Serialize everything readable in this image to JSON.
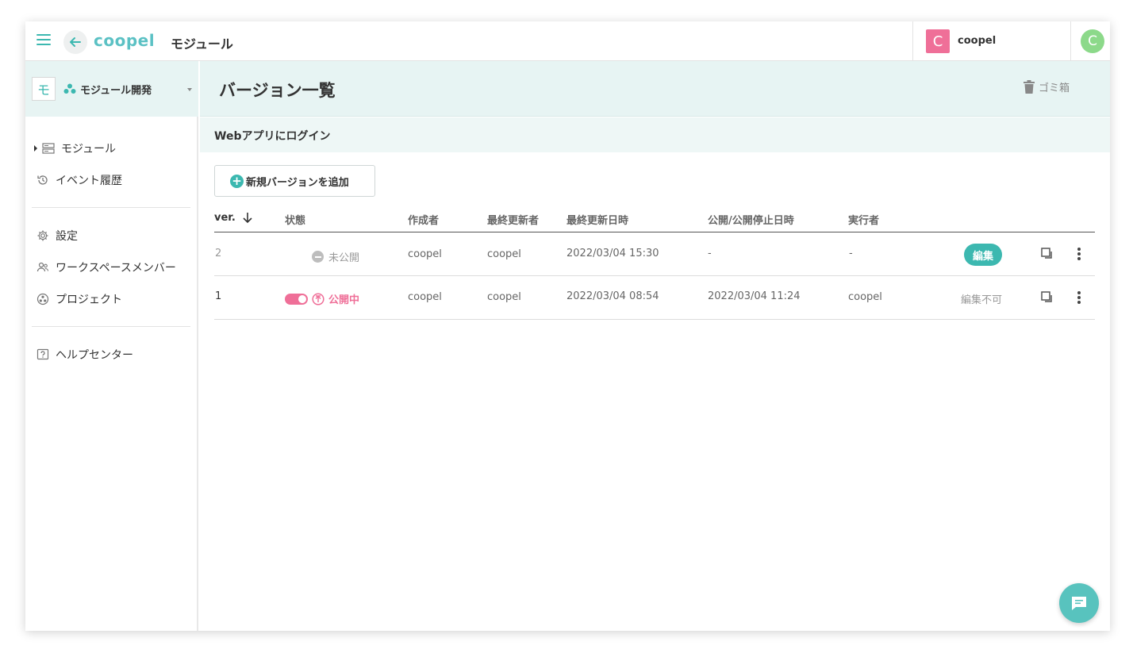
{
  "app": {
    "logo": "coopel",
    "title": "モジュール"
  },
  "workspace": {
    "avatar_letter": "C",
    "name": "coopel",
    "user_avatar_letter": "C"
  },
  "sidebar": {
    "project_icon_letter": "モ",
    "project_name": "モジュール開発",
    "items": [
      {
        "label": "モジュール",
        "icon": "server-icon"
      },
      {
        "label": "イベント履歴",
        "icon": "history-icon"
      },
      {
        "label": "設定",
        "icon": "gear-icon"
      },
      {
        "label": "ワークスペースメンバー",
        "icon": "people-icon"
      },
      {
        "label": "プロジェクト",
        "icon": "project-icon"
      },
      {
        "label": "ヘルプセンター",
        "icon": "help-icon"
      }
    ]
  },
  "main": {
    "page_title": "バージョン一覧",
    "trash_label": "ゴミ箱",
    "module_name": "Webアプリにログイン",
    "add_version_label": "新規バージョンを追加"
  },
  "table": {
    "headers": {
      "ver": "ver.",
      "status": "状態",
      "creator": "作成者",
      "last_updater": "最終更新者",
      "last_updated": "最終更新日時",
      "published": "公開/公開停止日時",
      "executor": "実行者"
    },
    "rows": [
      {
        "ver": "2",
        "status": "未公開",
        "creator": "coopel",
        "last_updater": "coopel",
        "last_updated": "2022/03/04 15:30",
        "published": "-",
        "executor": "-",
        "action": "編集"
      },
      {
        "ver": "1",
        "status": "公開中",
        "creator": "coopel",
        "last_updater": "coopel",
        "last_updated": "2022/03/04 08:54",
        "published": "2022/03/04 11:24",
        "executor": "coopel",
        "action": "編集不可"
      }
    ]
  },
  "colors": {
    "accent": "#3cb8b0",
    "header_bg": "#e7f4f3",
    "published": "#ef6f98"
  }
}
